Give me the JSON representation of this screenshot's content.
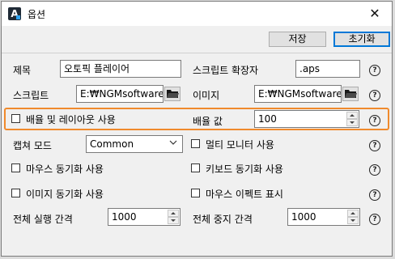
{
  "window": {
    "title": "옵션",
    "app_icon_letter": "A"
  },
  "toolbar": {
    "save_label": "저장",
    "reset_label": "초기화"
  },
  "form": {
    "title_label": "제목",
    "title_value": "오토픽 플레이어",
    "script_ext_label": "스크립트 확장자",
    "script_ext_value": ".aps",
    "script_label": "스크립트",
    "script_path": "E:₩NGMsoftware₩",
    "image_label": "이미지",
    "image_path": "E:₩NGMsoftware₩",
    "scale_layout_label": "배율 및 레이아웃 사용",
    "scale_value_label": "배율 값",
    "scale_value": "100",
    "capture_mode_label": "캡쳐 모드",
    "capture_mode_value": "Common",
    "multi_monitor_label": "멀티 모니터 사용",
    "mouse_sync_label": "마우스 동기화 사용",
    "keyboard_sync_label": "키보드 동기화 사용",
    "image_sync_label": "이미지 동기화 사용",
    "mouse_effect_label": "마우스 이펙트 표시",
    "run_interval_label": "전체 실행 간격",
    "run_interval_value": "1000",
    "stop_interval_label": "전체 중지 간격",
    "stop_interval_value": "1000"
  },
  "help_glyph": "?",
  "colors": {
    "highlight": "#f08a2c",
    "accent": "#0078d7"
  }
}
